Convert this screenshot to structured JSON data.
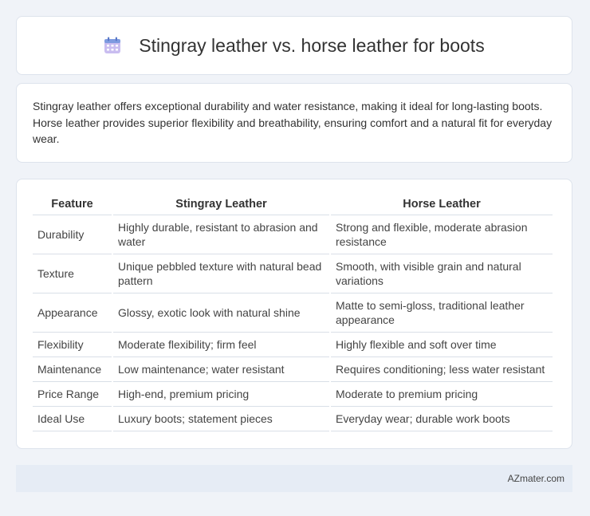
{
  "header": {
    "icon": "calendar-icon",
    "title": "Stingray leather vs. horse leather for boots"
  },
  "summary": {
    "text": "Stingray leather offers exceptional durability and water resistance, making it ideal for long-lasting boots. Horse leather provides superior flexibility and breathability, ensuring comfort and a natural fit for everyday wear."
  },
  "table": {
    "headers": [
      "Feature",
      "Stingray Leather",
      "Horse Leather"
    ],
    "rows": [
      [
        "Durability",
        "Highly durable, resistant to abrasion and water",
        "Strong and flexible, moderate abrasion resistance"
      ],
      [
        "Texture",
        "Unique pebbled texture with natural bead pattern",
        "Smooth, with visible grain and natural variations"
      ],
      [
        "Appearance",
        "Glossy, exotic look with natural shine",
        "Matte to semi-gloss, traditional leather appearance"
      ],
      [
        "Flexibility",
        "Moderate flexibility; firm feel",
        "Highly flexible and soft over time"
      ],
      [
        "Maintenance",
        "Low maintenance; water resistant",
        "Requires conditioning; less water resistant"
      ],
      [
        "Price Range",
        "High-end, premium pricing",
        "Moderate to premium pricing"
      ],
      [
        "Ideal Use",
        "Luxury boots; statement pieces",
        "Everyday wear; durable work boots"
      ]
    ]
  },
  "footer": {
    "brand": "AZmater.com"
  },
  "colors": {
    "background": "#f0f3f8",
    "card": "#ffffff",
    "footer": "#e6ecf5",
    "icon_blue": "#6b8fd6",
    "icon_purple": "#b9a6e8"
  }
}
